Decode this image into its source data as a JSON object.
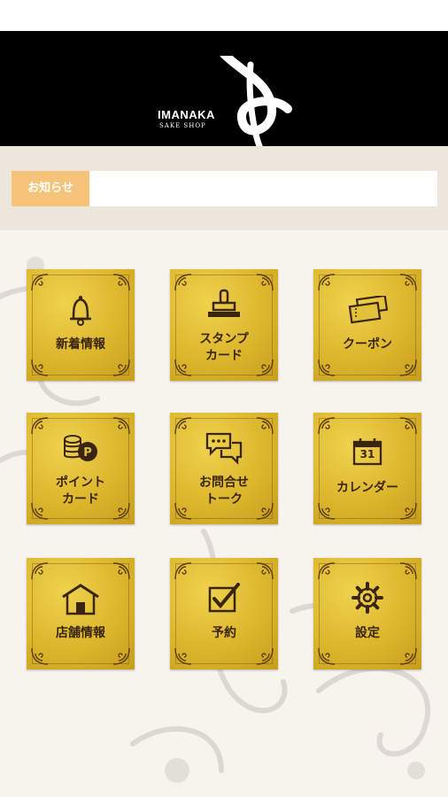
{
  "header": {
    "logo_text": "IMANAKA",
    "logo_sub": "SAKE SHOP"
  },
  "notice": {
    "label": "お知らせ",
    "content": ""
  },
  "menu": {
    "news": "新着情報",
    "stamp": "スタンプ\nカード",
    "coupon": "クーポン",
    "point": "ポイント\nカード",
    "talk": "お問合せ\nトーク",
    "calendar": "カレンダー",
    "calendar_day": "31",
    "shop": "店舗情報",
    "reserve": "予約",
    "settings": "設定"
  },
  "colors": {
    "gold": "#dcb62c",
    "brown": "#3a2412",
    "notice_label_bg": "#f5c37a"
  }
}
